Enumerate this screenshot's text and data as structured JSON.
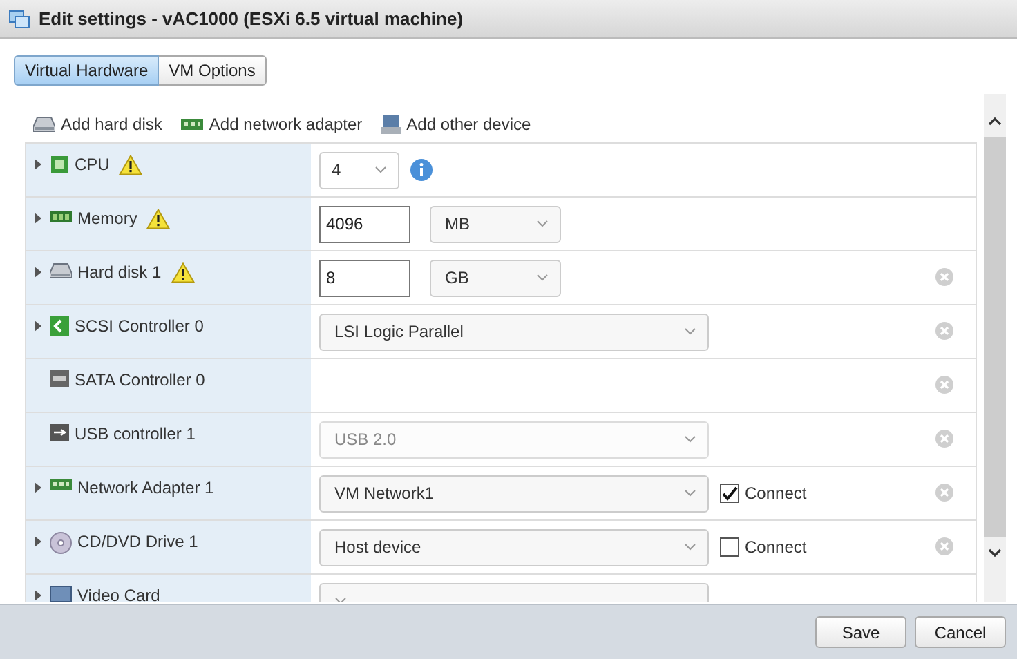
{
  "window": {
    "title": "Edit settings - vAC1000 (ESXi 6.5 virtual machine)"
  },
  "tabs": [
    {
      "label": "Virtual Hardware",
      "selected": true
    },
    {
      "label": "VM Options",
      "selected": false
    }
  ],
  "toolbar": [
    {
      "label": "Add hard disk",
      "kind": "disk"
    },
    {
      "label": "Add network adapter",
      "kind": "network"
    },
    {
      "label": "Add other device",
      "kind": "device"
    }
  ],
  "rows": [
    {
      "name": "CPU",
      "kind": "cpu",
      "expandable": true,
      "warning": true,
      "field": {
        "kind": "count",
        "value": "4"
      },
      "removable": false
    },
    {
      "name": "Memory",
      "kind": "memory",
      "expandable": true,
      "warning": true,
      "field": {
        "kind": "size",
        "value": "4096",
        "unit": "MB"
      },
      "removable": false
    },
    {
      "name": "Hard disk 1",
      "kind": "disk",
      "expandable": true,
      "warning": true,
      "field": {
        "kind": "size",
        "value": "8",
        "unit": "GB"
      },
      "removable": true
    },
    {
      "name": "SCSI Controller 0",
      "kind": "scsi",
      "expandable": true,
      "warning": false,
      "field": {
        "kind": "select",
        "value": "LSI Logic Parallel",
        "disabled": false
      },
      "removable": true
    },
    {
      "name": "SATA Controller 0",
      "kind": "sata",
      "expandable": false,
      "warning": false,
      "removable": true
    },
    {
      "name": "USB controller 1",
      "kind": "usb",
      "expandable": false,
      "warning": false,
      "field": {
        "kind": "select",
        "value": "USB 2.0",
        "disabled": true
      },
      "removable": true
    },
    {
      "name": "Network Adapter 1",
      "kind": "network",
      "expandable": true,
      "warning": false,
      "field": {
        "kind": "select",
        "value": "VM Network1",
        "disabled": false
      },
      "connect": {
        "label": "Connect",
        "checked": true
      },
      "removable": true
    },
    {
      "name": "CD/DVD Drive 1",
      "kind": "cd",
      "expandable": true,
      "warning": false,
      "field": {
        "kind": "select",
        "value": "Host device",
        "disabled": false
      },
      "connect": {
        "label": "Connect",
        "checked": false
      },
      "removable": true
    },
    {
      "name": "Video Card",
      "kind": "video",
      "expandable": true,
      "warning": false,
      "field": {
        "kind": "select",
        "disabled": false
      },
      "removable": false
    }
  ],
  "buttons": [
    "Save",
    "Cancel"
  ]
}
